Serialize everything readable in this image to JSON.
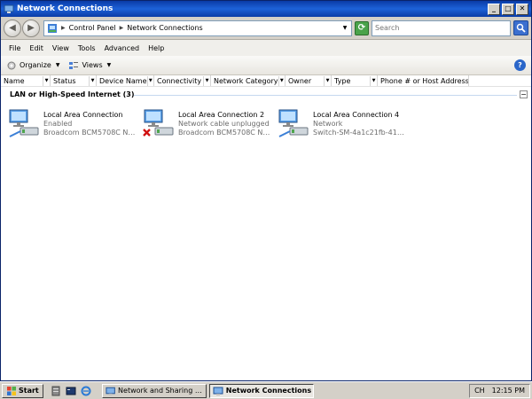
{
  "window": {
    "title": "Network Connections"
  },
  "address": {
    "crumbs": [
      "Control Panel",
      "Network Connections"
    ]
  },
  "search": {
    "placeholder": "Search"
  },
  "menu": [
    "File",
    "Edit",
    "View",
    "Tools",
    "Advanced",
    "Help"
  ],
  "toolbar": {
    "organize_label": "Organize",
    "views_label": "Views"
  },
  "columns": [
    {
      "label": "Name"
    },
    {
      "label": "Status"
    },
    {
      "label": "Device Name"
    },
    {
      "label": "Connectivity"
    },
    {
      "label": "Network Category"
    },
    {
      "label": "Owner"
    },
    {
      "label": "Type"
    },
    {
      "label": "Phone # or Host Address"
    }
  ],
  "group": {
    "label": "LAN or High-Speed Internet (3)"
  },
  "connections": [
    {
      "name": "Local Area Connection",
      "status": "Enabled",
      "device": "Broadcom BCM5708C Net...",
      "icon": "network-adapter-icon"
    },
    {
      "name": "Local Area Connection 2",
      "status": "Network cable unplugged",
      "device": "Broadcom BCM5708C Net...",
      "icon": "network-adapter-disconnected-icon"
    },
    {
      "name": "Local Area Connection 4",
      "status": "Network",
      "device": "Switch-SM-4a1c21fb-41dc...",
      "icon": "network-adapter-icon"
    }
  ],
  "taskbar": {
    "start_label": "Start",
    "tasks": [
      {
        "label": "Network and Sharing Ce..."
      },
      {
        "label": "Network Connections"
      }
    ],
    "tray": {
      "lang": "CH",
      "time": "12:15 PM"
    }
  },
  "colors": {
    "titlebar": "#0a3ba6",
    "desktop": "#3a6ea5",
    "chrome": "#d4d0c8",
    "accent": "#2a66c9"
  }
}
